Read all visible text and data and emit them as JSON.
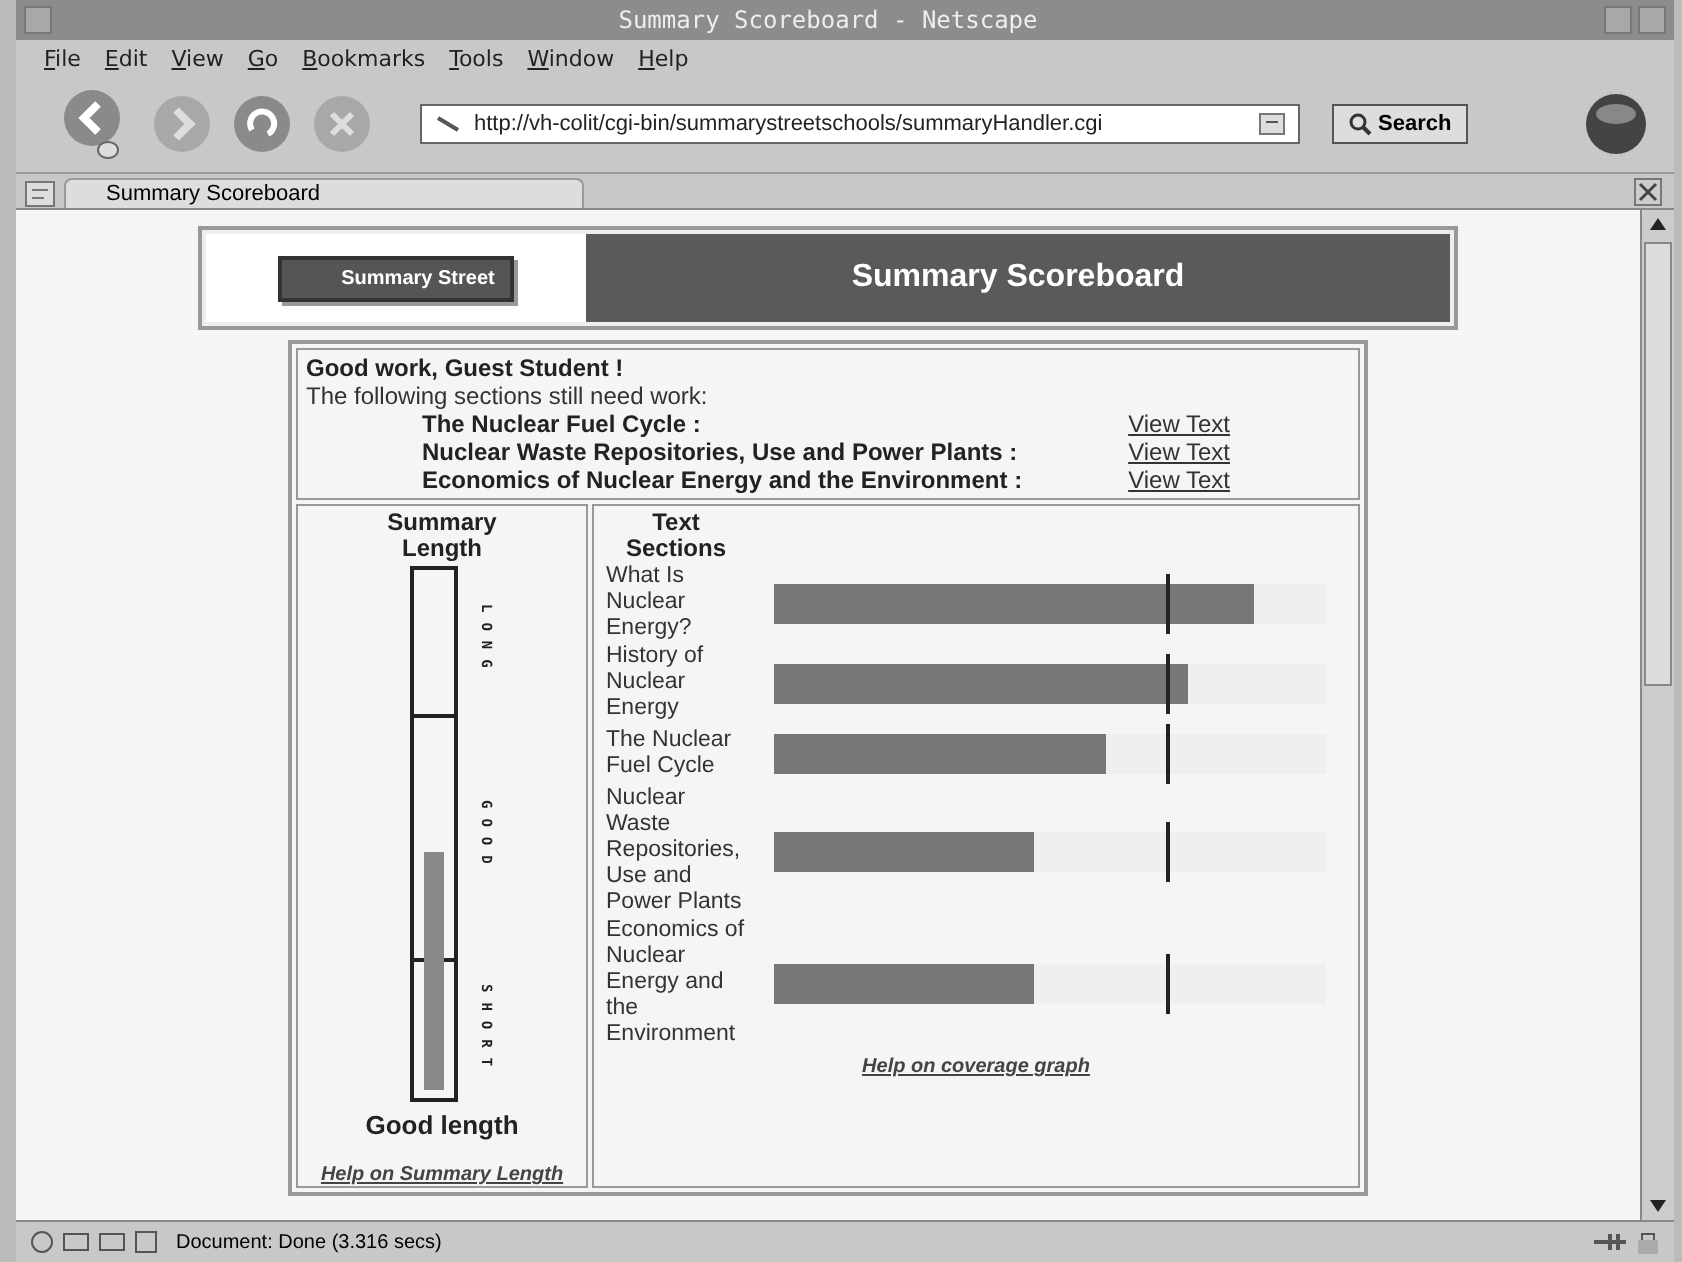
{
  "window": {
    "title": "Summary Scoreboard - Netscape"
  },
  "menu": [
    {
      "label": "File"
    },
    {
      "label": "Edit"
    },
    {
      "label": "View"
    },
    {
      "label": "Go"
    },
    {
      "label": "Bookmarks"
    },
    {
      "label": "Tools"
    },
    {
      "label": "Window"
    },
    {
      "label": "Help"
    }
  ],
  "toolbar": {
    "url": "http://vh-colit/cgi-bin/summarystreetschools/summaryHandler.cgi",
    "search_button": "Search"
  },
  "tabs": [
    {
      "label": "Summary Scoreboard",
      "selected": true
    }
  ],
  "page": {
    "logo_text": "Summary Street",
    "heading": "Summary Scoreboard",
    "greeting": "Good work, Guest Student !",
    "intro": "The following sections still need work:",
    "needs_work": [
      {
        "title": "The Nuclear Fuel Cycle :",
        "link": "View Text"
      },
      {
        "title": "Nuclear Waste Repositories, Use and Power Plants :",
        "link": "View Text"
      },
      {
        "title": "Economics of Nuclear Energy and the Environment :",
        "link": "View Text"
      }
    ],
    "length_meter": {
      "title": "Summary Length",
      "zones": [
        {
          "label": "LONG"
        },
        {
          "label": "GOOD"
        },
        {
          "label": "SHORT"
        }
      ],
      "level": 0.45,
      "verdict": "Good length",
      "help_link": "Help on Summary Length"
    },
    "coverage": {
      "title": "Text Sections",
      "sections": [
        {
          "name": "What Is Nuclear Energy?",
          "level": 0.87
        },
        {
          "name": "History of Nuclear Energy",
          "level": 0.75
        },
        {
          "name": "The Nuclear Fuel Cycle",
          "level": 0.6
        },
        {
          "name": "Nuclear Waste Repositories, Use and Power Plants",
          "level": 0.47
        },
        {
          "name": "Economics of Nuclear Energy and the Environment",
          "level": 0.47
        }
      ],
      "help_link": "Help on coverage graph"
    }
  },
  "status_bar": {
    "text": "Document: Done (3.316 secs)"
  }
}
